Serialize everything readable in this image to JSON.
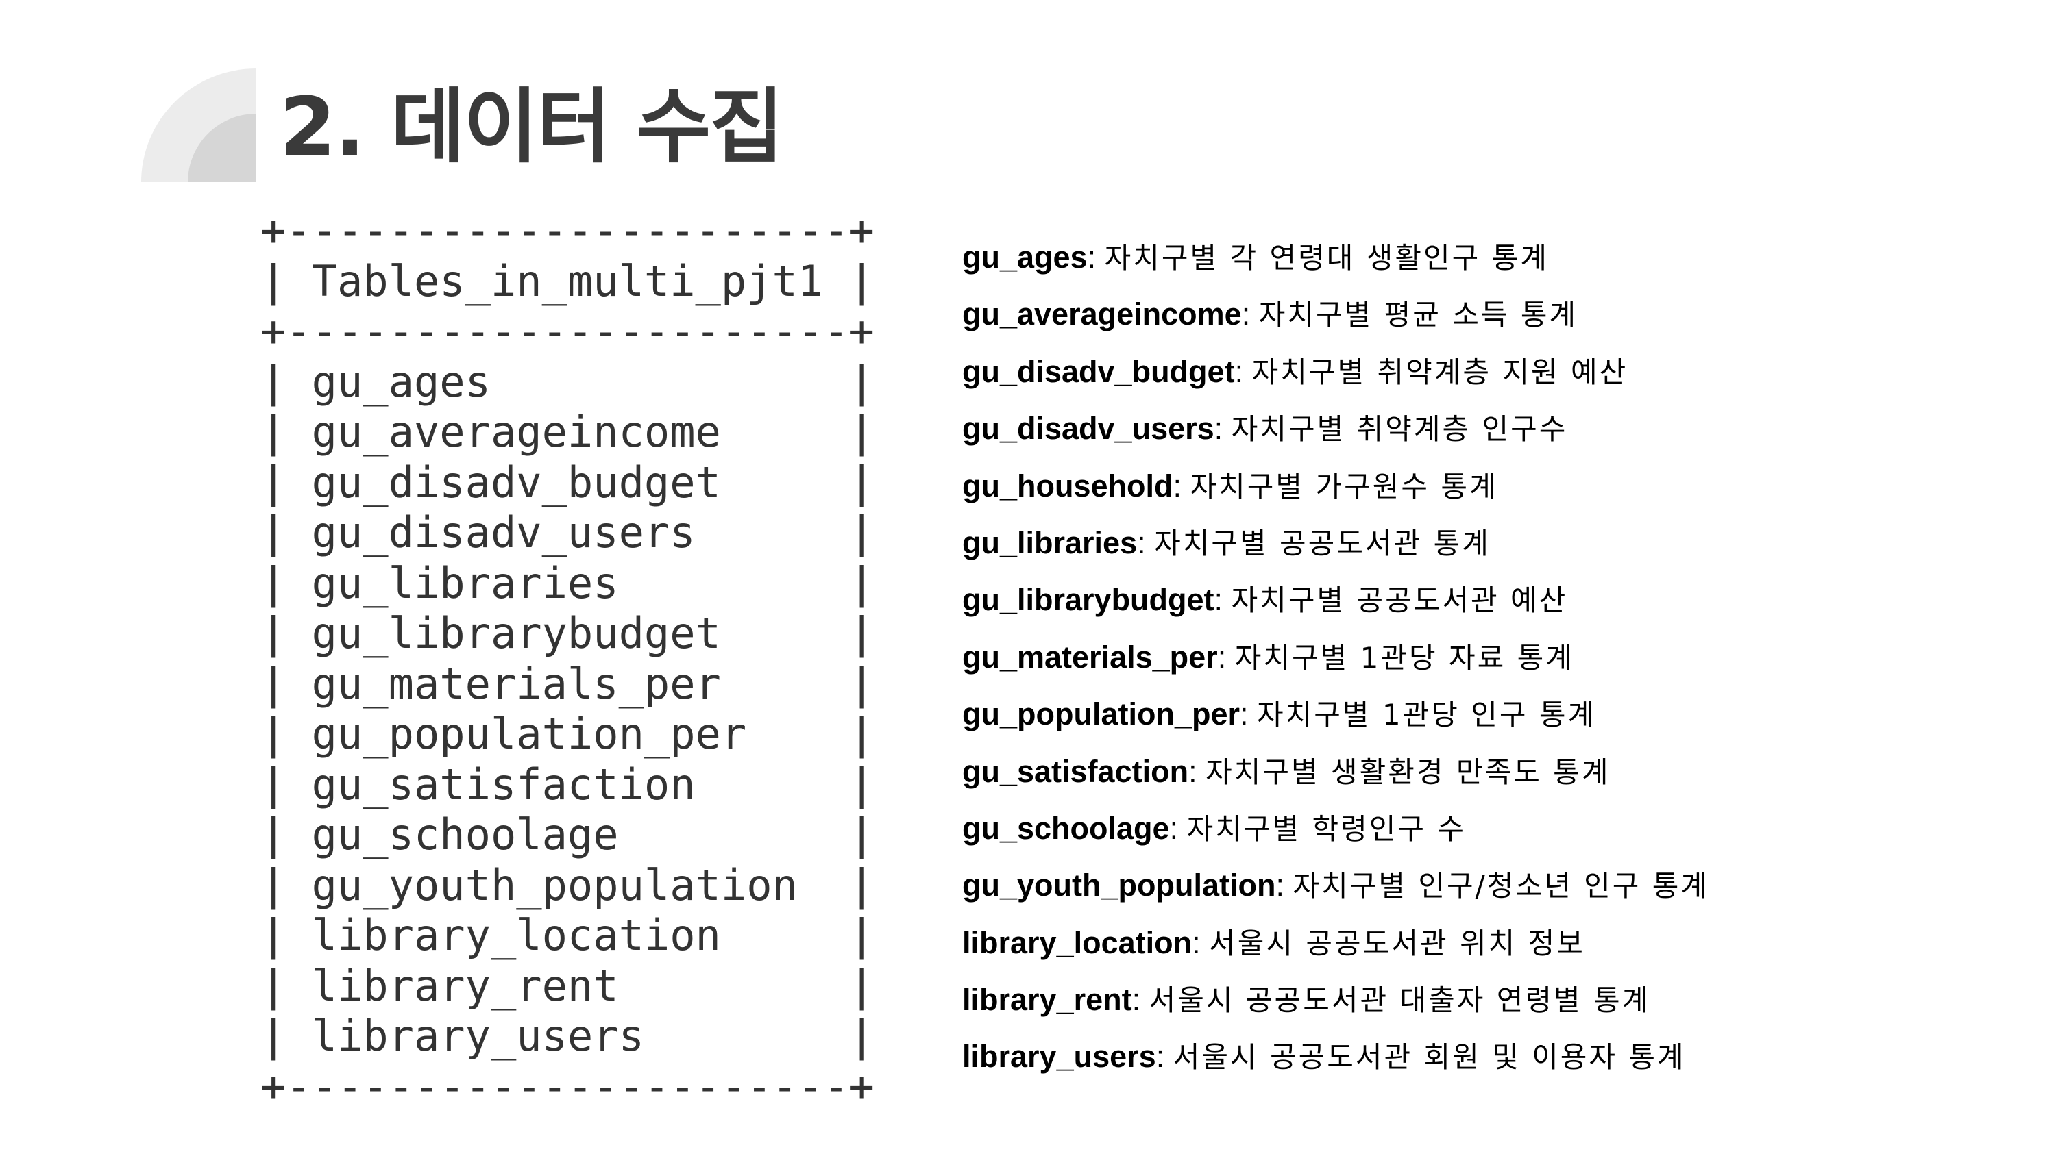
{
  "slide": {
    "title": "2. 데이터 수집",
    "accent_colors": {
      "deco_light": "#ececec",
      "deco_mid": "#d6d6d6",
      "title": "#3a3a3a"
    },
    "logo_icon": "quarter-circle-icon"
  },
  "table": {
    "border_top": "+----------------------+",
    "header": "| Tables_in_multi_pjt1 |",
    "border_mid": "+----------------------+",
    "rows": [
      "| gu_ages              |",
      "| gu_averageincome     |",
      "| gu_disadv_budget     |",
      "| gu_disadv_users      |",
      "| gu_libraries         |",
      "| gu_librarybudget     |",
      "| gu_materials_per     |",
      "| gu_population_per    |",
      "| gu_satisfaction      |",
      "| gu_schoolage         |",
      "| gu_youth_population  |",
      "| library_location     |",
      "| library_rent         |",
      "| library_users        |"
    ],
    "border_bottom": "+----------------------+"
  },
  "descriptions": [
    {
      "name": "gu_ages",
      "sep": ": ",
      "desc": "자치구별 각 연령대 생활인구 통계"
    },
    {
      "name": "gu_averageincome",
      "sep": ": ",
      "desc": "자치구별 평균 소득 통계"
    },
    {
      "name": "gu_disadv_budget",
      "sep": ": ",
      "desc": "자치구별 취약계층 지원 예산"
    },
    {
      "name": "gu_disadv_users",
      "sep": ": ",
      "desc": "자치구별 취약계층 인구수"
    },
    {
      "name": "gu_household",
      "sep": ": ",
      "desc": "자치구별 가구원수 통계"
    },
    {
      "name": "gu_libraries",
      "sep": ": ",
      "desc": "자치구별 공공도서관 통계"
    },
    {
      "name": "gu_librarybudget",
      "sep": ": ",
      "desc": "자치구별 공공도서관 예산"
    },
    {
      "name": "gu_materials_per",
      "sep": ": ",
      "desc": "자치구별 1관당 자료 통계"
    },
    {
      "name": "gu_population_per",
      "sep": ": ",
      "desc": "자치구별 1관당 인구 통계"
    },
    {
      "name": "gu_satisfaction",
      "sep": ": ",
      "desc": "자치구별 생활환경 만족도 통계"
    },
    {
      "name": "gu_schoolage",
      "sep": ": ",
      "desc": "자치구별 학령인구 수"
    },
    {
      "name": "gu_youth_population",
      "sep": ": ",
      "desc": "자치구별 인구/청소년 인구 통계"
    },
    {
      "name": "library_location",
      "sep": ": ",
      "desc": "서울시 공공도서관 위치 정보"
    },
    {
      "name": "library_rent",
      "sep": ": ",
      "desc": "서울시 공공도서관 대출자 연령별 통계"
    },
    {
      "name": "library_users",
      "sep": ": ",
      "desc": "서울시 공공도서관 회원 및 이용자 통계"
    }
  ]
}
